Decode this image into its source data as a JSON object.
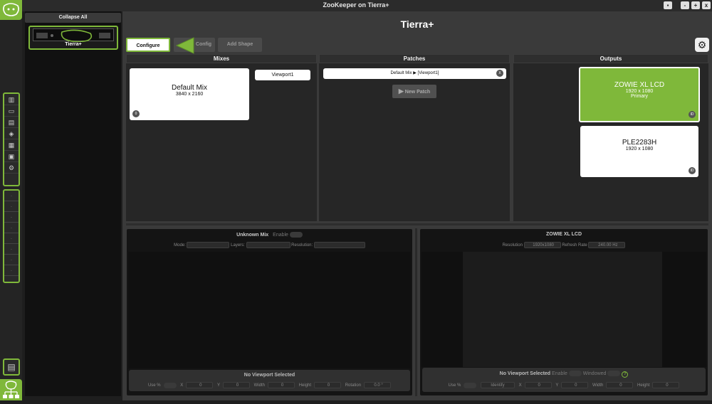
{
  "window": {
    "title": "ZooKeeper on Tierra+",
    "buttons": [
      "▪",
      "-",
      "+",
      "x"
    ]
  },
  "sidepanel": {
    "collapse_label": "Collapse All",
    "machine_name": "Tierra+"
  },
  "main": {
    "title": "Tierra+"
  },
  "tabs": {
    "configure": "Configure",
    "config": "Config",
    "add_shape": "Add Shape"
  },
  "mixes": {
    "header": "Mixes",
    "mix_name": "Default Mix",
    "mix_res": "3840 x 2160",
    "mix_badge": "0",
    "viewport_button": "Viewport1"
  },
  "patches": {
    "header": "Patches",
    "patch_source": "Default Mix",
    "patch_arrow": "▶",
    "patch_target": "[Viewport1]",
    "patch_badge": "X",
    "new_patch": "New Patch"
  },
  "outputs": {
    "header": "Outputs",
    "items": [
      {
        "name": "ZOWIE XL LCD",
        "res": "1920 x 1080",
        "role": "Primary",
        "badge": "ID"
      },
      {
        "name": "PLE2283H",
        "res": "1920 x 1080",
        "role": "",
        "badge": "ID"
      }
    ]
  },
  "mix_panel": {
    "title": "Unknown Mix",
    "enable": "Enable",
    "mode_label": "Mode:",
    "layers_label": "Layers:",
    "resolution_label": "Resolution:",
    "viewport_status": "No Viewport Selected",
    "fields": {
      "usepct": "Use %",
      "x": "X",
      "x_val": "0",
      "y": "Y",
      "y_val": "0",
      "width": "Width",
      "width_val": "0",
      "height": "Height",
      "height_val": "0",
      "rotation": "Rotation",
      "rotation_val": "0.0 °"
    }
  },
  "output_panel": {
    "title": "ZOWIE XL LCD",
    "resolution_label": "Resolution",
    "resolution_val": "1920x1080",
    "refresh_label": "Refresh Rate",
    "refresh_val": "240.00 Hz",
    "viewport_status": "No Viewport Selected",
    "enable": "Enable",
    "windowed": "Windowed",
    "help": "?",
    "fields": {
      "usepct": "Use %",
      "identify": "Identify",
      "x": "X",
      "x_val": "0",
      "y": "Y",
      "y_val": "0",
      "width": "Width",
      "width_val": "0",
      "height": "Height",
      "height_val": "0"
    }
  },
  "colors": {
    "accent": "#7fb83a",
    "bg": "#1e1e1e",
    "panel": "#262626"
  }
}
